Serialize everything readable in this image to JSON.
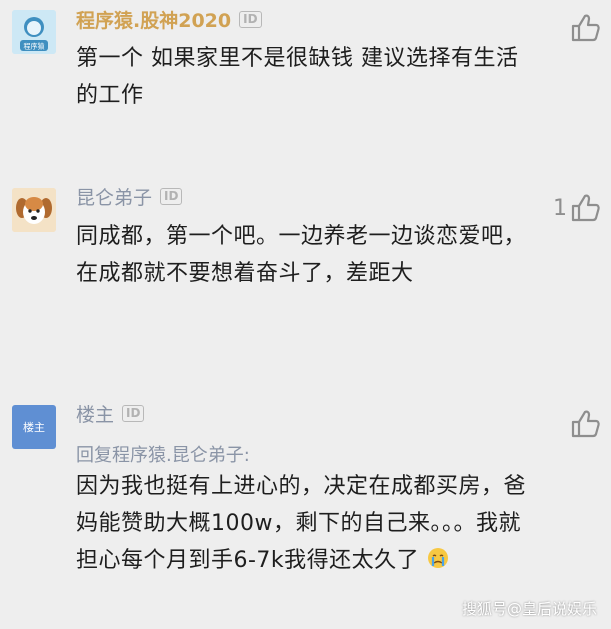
{
  "comments": [
    {
      "username": "程序猿.股神2020",
      "id_badge": "ID",
      "avatar_label": "程序猿",
      "text": "第一个 如果家里不是很缺钱 建议选择有生活的工作",
      "likes": ""
    },
    {
      "username": "昆仑弟子",
      "id_badge": "ID",
      "text": "同成都，第一个吧。一边养老一边谈恋爱吧，在成都就不要想着奋斗了，差距大",
      "likes": "1"
    },
    {
      "username": "楼主",
      "id_badge": "ID",
      "avatar_label": "楼主",
      "reply_to": "回复程序猿.昆仑弟子:",
      "text": "因为我也挺有上进心的，决定在成都买房，爸妈能赞助大概100w，剩下的自己来。。。我就担心每个月到手6-7k我得还太久了",
      "emoji": "crying-face",
      "likes": ""
    }
  ],
  "watermark": "搜狐号@皇后说娱乐",
  "colors": {
    "background": "#eeeeee",
    "brand_name": "#d1a253",
    "name": "#8a94a6",
    "text": "#1e1e1e",
    "icon": "#8e8e8e"
  },
  "icons": [
    "thumbs-up-icon",
    "id-badge-icon",
    "crying-face-icon"
  ]
}
